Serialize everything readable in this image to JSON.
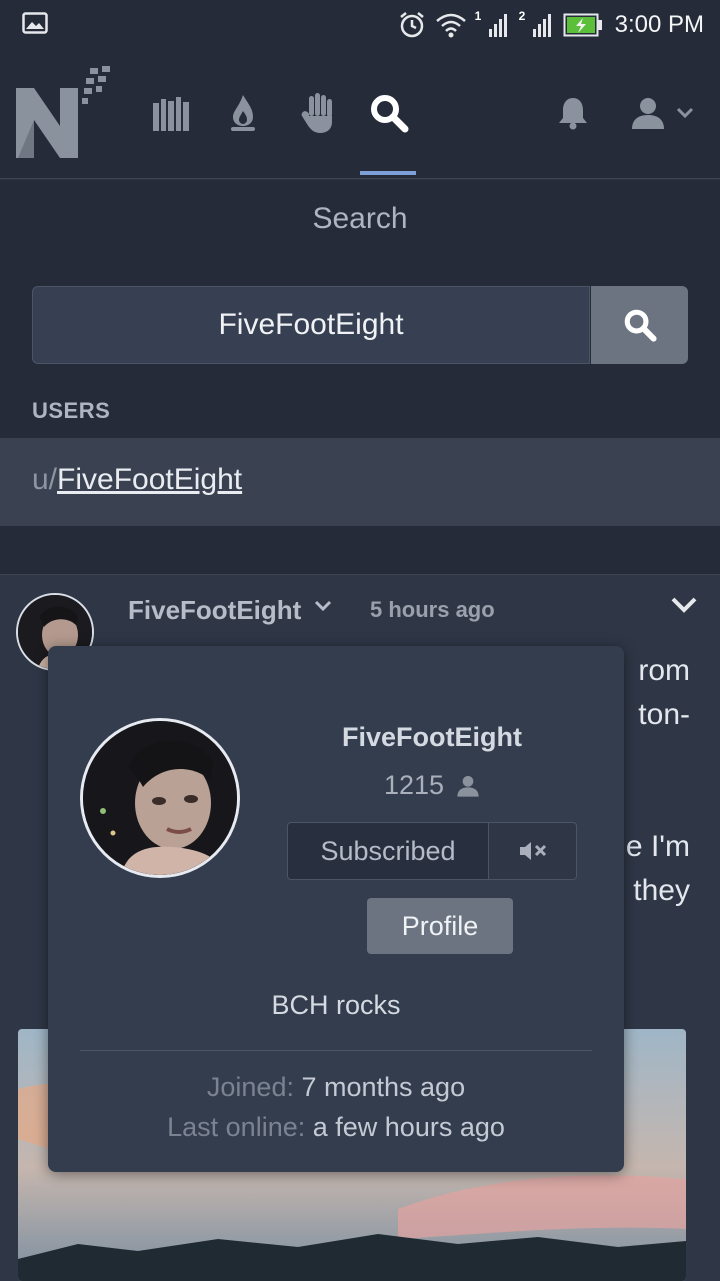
{
  "status_bar": {
    "time": "3:00 PM",
    "sim1": "1",
    "sim2": "2"
  },
  "nav": {
    "logo": "N",
    "icons": [
      "library-icon",
      "flame-icon",
      "hand-icon",
      "search-icon",
      "bell-icon",
      "user-icon"
    ],
    "active_tab": "search"
  },
  "search": {
    "title": "Search",
    "query": "FiveFootEight",
    "users_label": "USERS",
    "result_prefix": "u/",
    "result_username": "FiveFootEight"
  },
  "post": {
    "author": "FiveFootEight",
    "time": "5 hours ago",
    "text_lines": [
      "rom",
      "ton-",
      "",
      "",
      "e I'm",
      "they"
    ]
  },
  "popup": {
    "username": "FiveFootEight",
    "subscriber_count": "1215",
    "subscribed_label": "Subscribed",
    "profile_label": "Profile",
    "bio": "BCH rocks",
    "joined_label": "Joined:",
    "joined_value": "7 months ago",
    "last_online_label": "Last online:",
    "last_online_value": "a few hours ago"
  },
  "colors": {
    "accent": "#7da0d8",
    "background": "#2d3443",
    "nav": "#252b38"
  }
}
